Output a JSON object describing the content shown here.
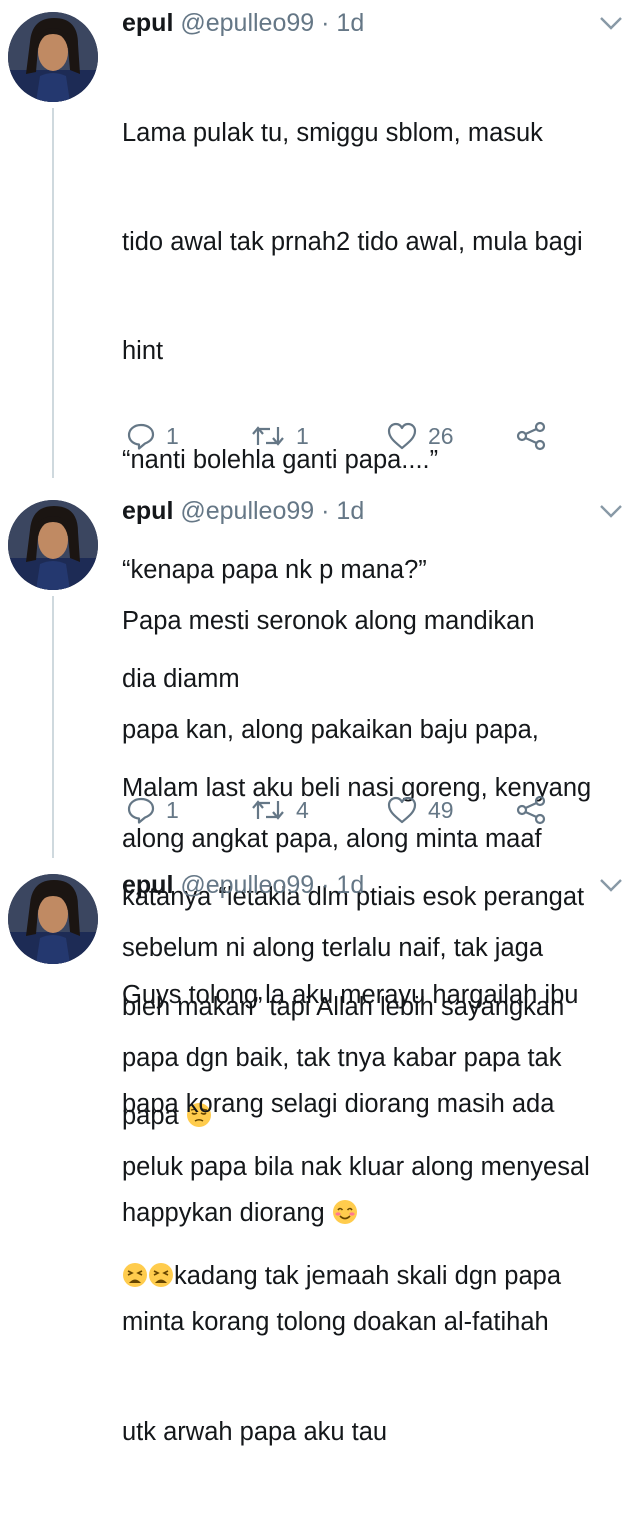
{
  "tweets": [
    {
      "name": "epul",
      "handle": "@epulleo99",
      "dot": "·",
      "time": "1d",
      "lines": [
        "Lama pulak tu, smiggu sblom, masuk",
        "tido awal tak prnah2 tido awal, mula bagi",
        "hint",
        "“nanti bolehla ganti papa....”",
        "“kenapa papa nk p mana?”",
        "dia diamm",
        "Malam last aku beli nasi goreng, kenyang",
        "katanya “letakla dlm ptiais esok perangat",
        "bleh makan” tapi Allah lebih sayangkan",
        "papa"
      ],
      "emoji_after_last_line": "pensive-face",
      "replies": "1",
      "retweets": "1",
      "likes": "26"
    },
    {
      "name": "epul",
      "handle": "@epulleo99",
      "dot": "·",
      "time": "1d",
      "lines": [
        "Papa mesti seronok along mandikan",
        "papa kan, along pakaikan baju papa,",
        "along angkat papa, along minta maaf",
        "sebelum ni along terlalu naif, tak jaga",
        "papa dgn baik, tak tnya kabar papa tak",
        "peluk papa bila nak kluar along menyesal",
        "kadang tak jemaah skali dgn papa"
      ],
      "emoji_before_last_line": "weary-face x2",
      "replies": "1",
      "retweets": "4",
      "likes": "49"
    },
    {
      "name": "epul",
      "handle": "@epulleo99",
      "dot": "·",
      "time": "1d",
      "lines": [
        "Guys tolong la aku merayu hargailah ibu",
        "bapa korang selagi diorang masih ada",
        "happykan diorang",
        "minta korang tolong doakan al-fatihah",
        "utk arwah papa aku tau"
      ],
      "emoji_after_line_3": "smiling-face-with-smiling-eyes"
    }
  ],
  "colors": {
    "text": "#14171a",
    "muted": "#657786",
    "thread_line": "#cfd9de",
    "emoji": "#ffcc4d"
  }
}
